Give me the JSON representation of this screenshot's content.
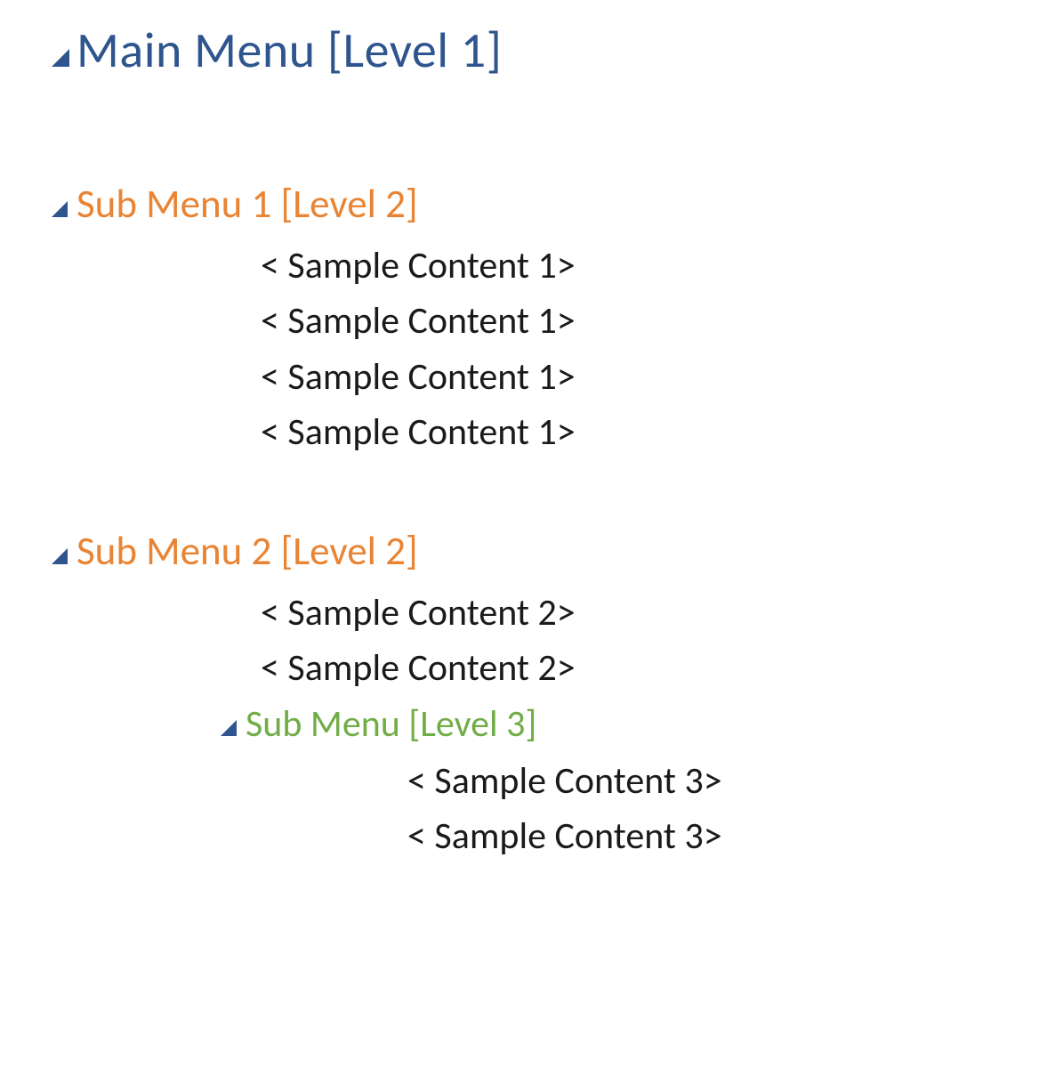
{
  "colors": {
    "triangle_fill": "#2e558e",
    "level1": "#2e558e",
    "level2": "#e88433",
    "level3": "#70ad47",
    "body": "#1a1a1a"
  },
  "outline": {
    "level1": {
      "title": "Main Menu [Level 1]"
    },
    "subs": [
      {
        "title": "Sub Menu 1 [Level 2]",
        "content": [
          "< Sample Content 1>",
          "< Sample Content 1>",
          "< Sample Content 1>",
          "< Sample Content 1>"
        ]
      },
      {
        "title": "Sub Menu 2 [Level 2]",
        "content": [
          "< Sample Content 2>",
          "< Sample Content 2>"
        ],
        "sub": {
          "title": "Sub Menu [Level 3]",
          "content": [
            "< Sample Content 3>",
            "< Sample Content 3>"
          ]
        }
      }
    ]
  }
}
